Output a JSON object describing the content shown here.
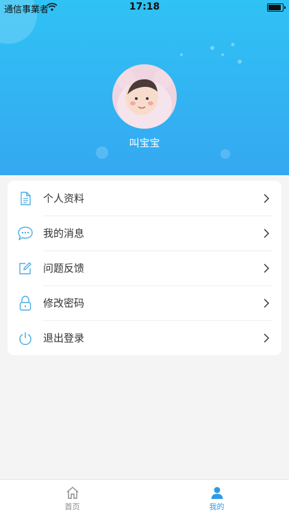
{
  "status_bar": {
    "carrier": "通信事業者",
    "time": "17:18"
  },
  "profile": {
    "name": "叫宝宝"
  },
  "menu": {
    "items": [
      {
        "label": "个人资料",
        "icon": "document-icon"
      },
      {
        "label": "我的消息",
        "icon": "message-icon"
      },
      {
        "label": "问题反馈",
        "icon": "edit-icon"
      },
      {
        "label": "修改密码",
        "icon": "lock-icon"
      },
      {
        "label": "退出登录",
        "icon": "power-icon"
      }
    ]
  },
  "tabbar": {
    "tabs": [
      {
        "label": "首页",
        "icon": "home-icon",
        "active": false
      },
      {
        "label": "我的",
        "icon": "user-icon",
        "active": true
      }
    ]
  },
  "colors": {
    "header_top": "#2fc2f4",
    "header_bottom": "#35a8f1",
    "accent": "#2f9be8",
    "icon": "#4aaee6"
  }
}
